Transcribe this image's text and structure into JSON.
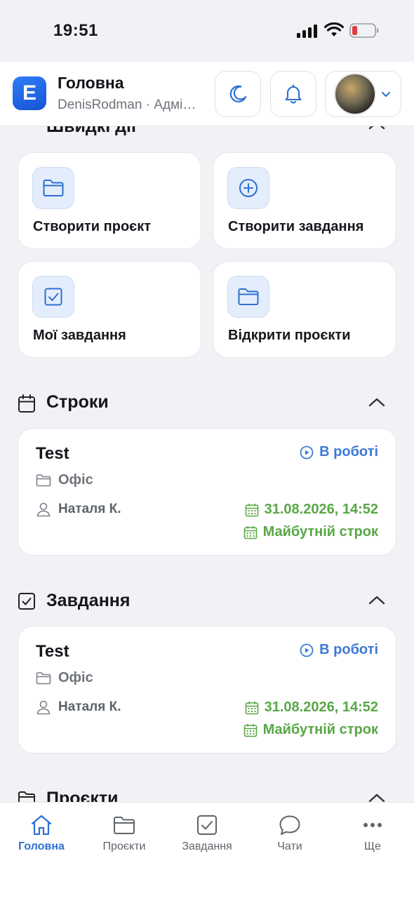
{
  "status_bar": {
    "time": "19:51"
  },
  "header": {
    "app_letter": "E",
    "title": "Головна",
    "subtitle": "DenisRodman · Адміністратор"
  },
  "quick_actions": {
    "title": "Швидкі дії",
    "items": [
      {
        "label": "Створити проєкт",
        "icon": "folder-icon"
      },
      {
        "label": "Створити завдання",
        "icon": "plus-circle-icon"
      },
      {
        "label": "Мої завдання",
        "icon": "checkbox-icon"
      },
      {
        "label": "Відкрити проєкти",
        "icon": "folder-icon"
      }
    ]
  },
  "deadlines": {
    "title": "Строки",
    "card": {
      "title": "Test",
      "status": "В роботі",
      "project": "Офіс",
      "assignee": "Наталя К.",
      "date": "31.08.2026, 14:52",
      "due_label": "Майбутній строк"
    }
  },
  "tasks": {
    "title": "Завдання",
    "card": {
      "title": "Test",
      "status": "В роботі",
      "project": "Офіс",
      "assignee": "Наталя К.",
      "date": "31.08.2026, 14:52",
      "due_label": "Майбутній строк"
    }
  },
  "projects": {
    "title": "Проєкти"
  },
  "tabbar": {
    "items": [
      {
        "label": "Головна",
        "icon": "home-icon",
        "active": true
      },
      {
        "label": "Проєкти",
        "icon": "folder-icon",
        "active": false
      },
      {
        "label": "Завдання",
        "icon": "checkbox-icon",
        "active": false
      },
      {
        "label": "Чати",
        "icon": "chat-bubble-icon",
        "active": false
      },
      {
        "label": "Ще",
        "icon": "more-dots-icon",
        "active": false
      }
    ]
  },
  "colors": {
    "accent": "#2f6fd1",
    "status_blue": "#3d7ad6",
    "due_green": "#58a746",
    "background": "#f1f2f6"
  }
}
